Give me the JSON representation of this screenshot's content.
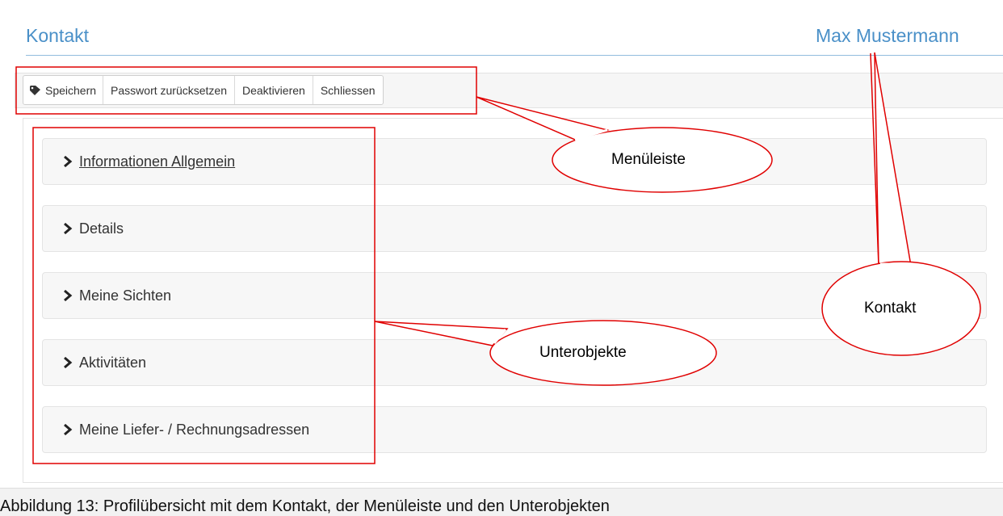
{
  "header": {
    "title": "Kontakt",
    "user_name": "Max Mustermann"
  },
  "toolbar": {
    "buttons": [
      {
        "label": "Speichern",
        "icon": "tag-icon"
      },
      {
        "label": "Passwort zurücksetzen"
      },
      {
        "label": "Deaktivieren"
      },
      {
        "label": "Schliessen"
      }
    ]
  },
  "sections": [
    {
      "label": " Informationen Allgemein",
      "icon": "chevron-right-icon"
    },
    {
      "label": "Details",
      "icon": "chevron-right-icon"
    },
    {
      "label": "Meine Sichten",
      "icon": "chevron-right-icon"
    },
    {
      "label": "Aktivitäten",
      "icon": "chevron-right-icon"
    },
    {
      "label": "Meine Liefer- / Rechnungsadressen",
      "icon": "chevron-right-icon"
    }
  ],
  "annotations": {
    "menu": "Menüleiste",
    "contact": "Kontakt",
    "subobjects": "Unterobjekte",
    "color": "#e00000"
  },
  "caption": "Abbildung 13: Profilübersicht mit dem Kontakt, der Menüleiste und den Unterobjekten",
  "colors": {
    "accent": "#4a90c8",
    "annotation": "#e00000"
  }
}
